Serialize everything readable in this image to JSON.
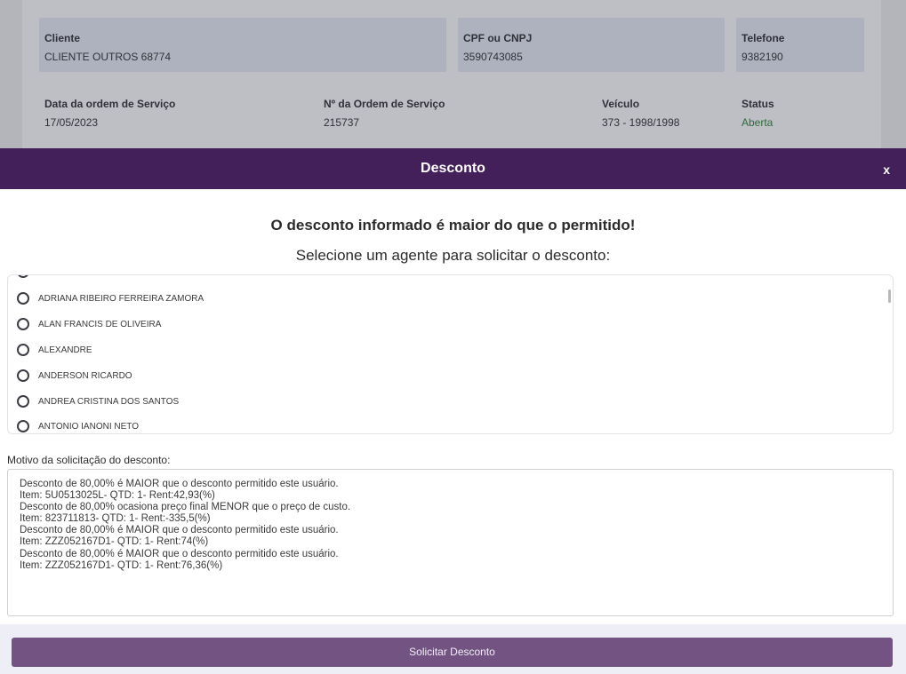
{
  "background": {
    "cliente": {
      "label": "Cliente",
      "value": "CLIENTE OUTROS 68774"
    },
    "cpf": {
      "label": "CPF ou CNPJ",
      "value": "3590743085"
    },
    "telefone": {
      "label": "Telefone",
      "value": "9382190"
    },
    "data_ordem": {
      "label": "Data da ordem de Serviço",
      "value": "17/05/2023"
    },
    "numero_ordem": {
      "label": "Nº da Ordem de Serviço",
      "value": "215737"
    },
    "veiculo": {
      "label": "Veículo",
      "value": "373 - 1998/1998"
    },
    "status": {
      "label": "Status",
      "value": "Aberta",
      "color": "#2f6a3c"
    }
  },
  "modal": {
    "title": "Desconto",
    "close_label": "x",
    "header_color": "#44205a",
    "warning": "O desconto informado é maior do que o permitido!",
    "subtitle": "Selecione um agente para solicitar o desconto:",
    "agents": [
      "ADRIANA RIBEIRO FERREIRA ZAMORA",
      "ALAN FRANCIS DE OLIVEIRA",
      "ALEXANDRE",
      "ANDERSON RICARDO",
      "ANDREA CRISTINA DOS SANTOS",
      "ANTONIO IANONI NETO"
    ],
    "reason_label": "Motivo da solicitação do desconto:",
    "reason_text": "Desconto de 80,00% é MAIOR que o desconto permitido este usuário.\nItem: 5U0513025L- QTD: 1- Rent:42,93(%)\nDesconto de 80,00% ocasiona preço final MENOR que o preço de custo.\nItem: 823711813- QTD: 1- Rent:-335,5(%)\nDesconto de 80,00% é MAIOR que o desconto permitido este usuário.\nItem: ZZZ052167D1- QTD: 1- Rent:74(%)\nDesconto de 80,00% é MAIOR que o desconto permitido este usuário.\nItem: ZZZ052167D1- QTD: 1- Rent:76,36(%)",
    "submit_label": "Solicitar Desconto",
    "submit_color": "#725382"
  }
}
